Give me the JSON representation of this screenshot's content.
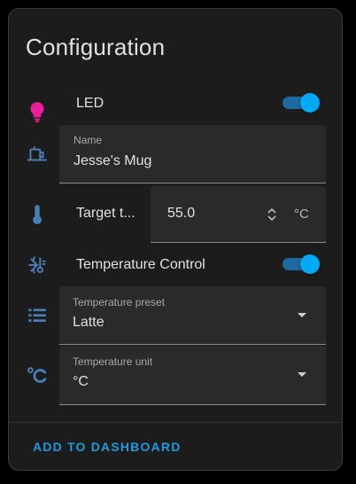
{
  "card": {
    "title": "Configuration"
  },
  "rows": {
    "led": {
      "label": "LED",
      "icon": "lightbulb-icon",
      "toggle_on": true
    },
    "name": {
      "label": "Name",
      "value": "Jesse's Mug",
      "icon": "mug-icon"
    },
    "target_temp": {
      "label": "Target t...",
      "value": "55.0",
      "unit": "°C",
      "icon": "thermometer-icon"
    },
    "temp_control": {
      "label": "Temperature Control",
      "icon": "snowflake-thermometer-icon",
      "toggle_on": true
    },
    "temp_preset": {
      "label": "Temperature preset",
      "value": "Latte",
      "icon": "list-icon"
    },
    "temp_unit": {
      "label": "Temperature unit",
      "value": "°C",
      "icon": "celsius-icon"
    }
  },
  "footer": {
    "add_label": "ADD TO DASHBOARD"
  },
  "colors": {
    "background": "#1c1c1c",
    "accent": "#03a9f4",
    "icon_blue": "#4a7fb5",
    "led_icon": "#e91e9b"
  }
}
